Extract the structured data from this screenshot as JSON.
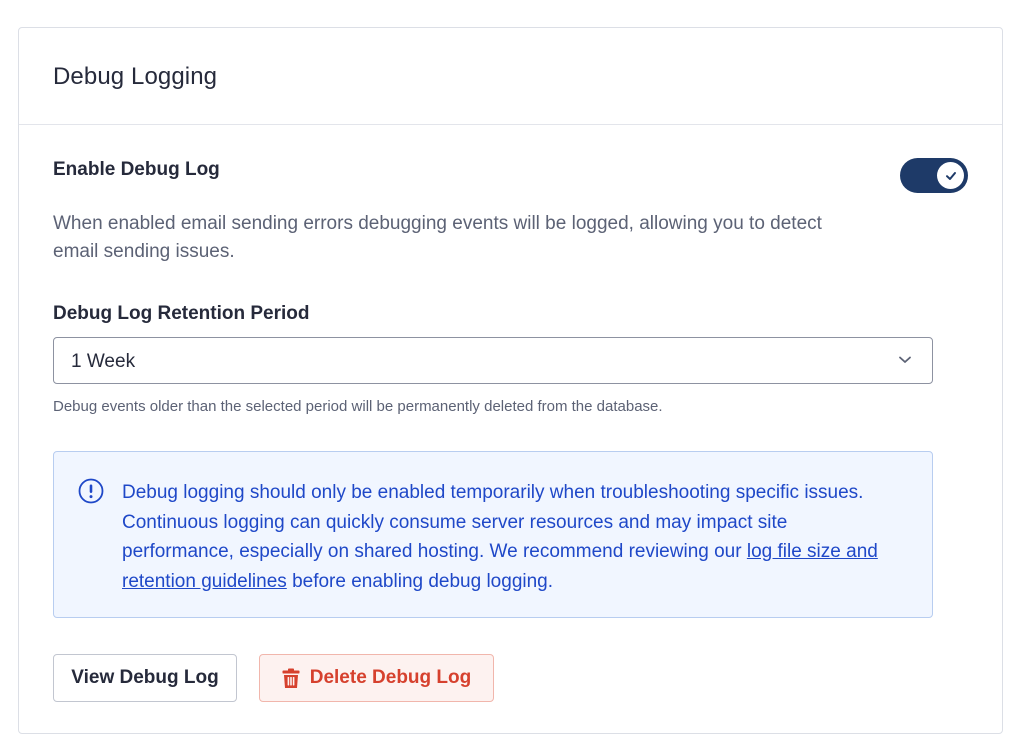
{
  "card": {
    "title": "Debug Logging"
  },
  "debug_log": {
    "label": "Enable Debug Log",
    "enabled": true,
    "description": "When enabled email sending errors debugging events will be logged, allowing you to detect email sending issues."
  },
  "retention": {
    "label": "Debug Log Retention Period",
    "selected": "1 Week",
    "help": "Debug events older than the selected period will be permanently deleted from the database."
  },
  "notice": {
    "text_before": "Debug logging should only be enabled temporarily when troubleshooting specific issues. Continuous logging can quickly consume server resources and may impact site performance, especially on shared hosting. We recommend reviewing our ",
    "link_text": "log file size and retention guidelines",
    "text_after": " before enabling debug logging.",
    "icon": "exclamation-circle-icon"
  },
  "actions": {
    "view_label": "View Debug Log",
    "delete_label": "Delete Debug Log",
    "delete_icon": "trash-icon"
  },
  "colors": {
    "toggle_on": "#1e3a68",
    "notice_text": "#1f48c8",
    "danger": "#d6412e"
  }
}
